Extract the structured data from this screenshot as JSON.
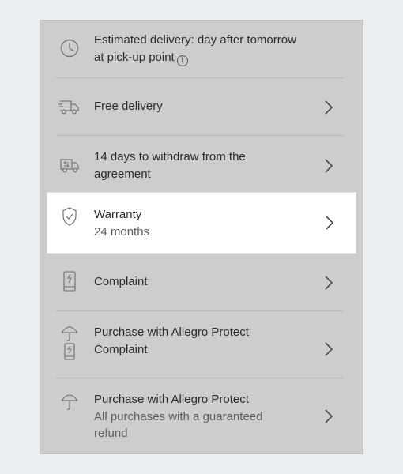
{
  "delivery": {
    "line1": "Estimated delivery: day after tomorrow",
    "line2": "at pick-up point",
    "icon": "clock-icon"
  },
  "items": [
    {
      "title": "Free delivery",
      "subtitle": "",
      "icon": "delivery-truck-icon"
    },
    {
      "title": "14 days to withdraw from the",
      "title2": "agreement",
      "subtitle": "",
      "icon": "return-truck-icon"
    },
    {
      "title": "Warranty",
      "subtitle": "24 months",
      "icon": "shield-check-icon"
    },
    {
      "title": "Complaint",
      "subtitle": "",
      "icon": "phone-complaint-icon"
    },
    {
      "title": "Purchase with Allegro Protect",
      "subtitle": "Complaint",
      "icon": "umbrella-phone-icon"
    },
    {
      "title": "Purchase with Allegro Protect",
      "subtitle": "All purchases with a guaranteed",
      "subtitle2": "refund",
      "icon": "umbrella-icon"
    }
  ],
  "colors": {
    "page_bg": "#eceff1",
    "panel_bg": "#cdcdcd",
    "highlight_bg": "#ffffff",
    "text": "#2b2b2b",
    "subtext": "#5e5e5e"
  }
}
